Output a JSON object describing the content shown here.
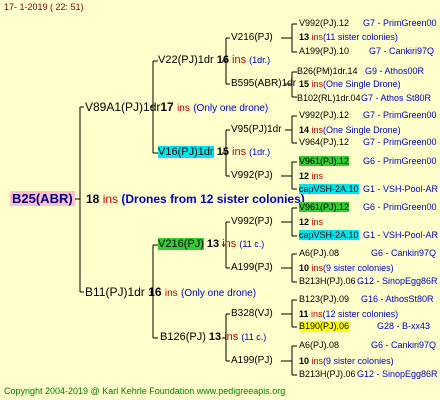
{
  "header": {
    "date": "17-  1-2019 (  22: 51)"
  },
  "footer": {
    "copyright": "Copyright 2004-2019 @ Karl Kehrle Foundation   www.pedigreeapis.org"
  },
  "root": {
    "name": "B25(ABR)",
    "count": "18",
    "unit": "ins",
    "note": "(Drones from 12 sister colonies)"
  },
  "gen1": {
    "upper": {
      "name": "V89A1(PJ)1dr",
      "count": "17",
      "unit": "ins",
      "note": "(Only one drone)"
    },
    "lower": {
      "name": "B11(PJ)1dr",
      "count": "16",
      "unit": "ins",
      "note": "(Only one drone)"
    }
  },
  "gen2": {
    "a": {
      "name": "V22(PJ)1dr",
      "count": "16",
      "unit": "ins",
      "note": "(1dr.)"
    },
    "b": {
      "name": "V16(PJ)1dr",
      "count": "15",
      "unit": "ins",
      "note": "(1dr.)"
    },
    "c": {
      "name": "V216(PJ)",
      "count": "13",
      "unit": "ins",
      "note": "(11 c.)"
    },
    "d": {
      "name": "B126(PJ)",
      "count": "13",
      "unit": "ins",
      "note": "(11 c.)"
    }
  },
  "gen3": {
    "a": {
      "name": "V216(PJ)",
      "count": "13",
      "unit": "ins",
      "note": "(11 sister colonies)"
    },
    "b": {
      "name": "B595(ABR)1dr",
      "count": "15",
      "unit": "ins",
      "note": "(One Single Drone)"
    },
    "c": {
      "name": "V95(PJ)1dr",
      "count": "14",
      "unit": "ins",
      "note": "(One Single Drone)"
    },
    "d": {
      "name": "V992(PJ)",
      "count": "12",
      "unit": "ins",
      "note": ""
    },
    "e": {
      "name": "V992(PJ)",
      "count": "12",
      "unit": "ins",
      "note": ""
    },
    "f": {
      "name": "A199(PJ)",
      "count": "10",
      "unit": "ins",
      "note": "(9 sister colonies)"
    },
    "g": {
      "name": "B328(VJ)",
      "count": "11",
      "unit": "ins",
      "note": "(12 sister colonies)"
    },
    "h": {
      "name": "A199(PJ)",
      "count": "10",
      "unit": "ins",
      "note": "(9 sister colonies)"
    }
  },
  "gen4": [
    {
      "name": "V992(PJ).12",
      "ref": "G7 - PrimGreen00"
    },
    {
      "name": "A199(PJ).10",
      "ref": "G7 - Cankiri97Q"
    },
    {
      "name": "B26(PM)1dr.14",
      "ref": "G9 - Athos00R"
    },
    {
      "name": "B102(RL)1dr.04",
      "ref": "G7 - Athos St80R"
    },
    {
      "name": "V992(PJ).12",
      "ref": "G7 - PrimGreen00"
    },
    {
      "name": "V964(PJ).12",
      "ref": "G7 - PrimGreen00"
    },
    {
      "name": "V961(PJ).12",
      "ref": "G6 - PrimGreen00"
    },
    {
      "name": "capVSH-2A.10",
      "ref": "G1 - VSH-Pool-AR"
    },
    {
      "name": "V961(PJ).12",
      "ref": "G6 - PrimGreen00"
    },
    {
      "name": "capVSH-2A.10",
      "ref": "G1 - VSH-Pool-AR"
    },
    {
      "name": "A6(PJ).08",
      "ref": "G6 - Cankiri97Q"
    },
    {
      "name": "B213H(PJ).06",
      "ref": "G12 - SinopEgg86R"
    },
    {
      "name": "B123(PJ).09",
      "ref": "G16 - AthosSt80R"
    },
    {
      "name": "B190(PJ).06",
      "ref": "G28 - B-xx43"
    },
    {
      "name": "A6(PJ).08",
      "ref": "G6 - Cankiri97Q"
    },
    {
      "name": "B213H(PJ).06",
      "ref": "G12 - SinopEgg86R"
    }
  ],
  "colors": {
    "background": "#ffffcc",
    "lines": "#000000",
    "highlight_green": "#33cc33",
    "highlight_cyan": "#00e5ee",
    "highlight_yellow": "#ffff00",
    "root_bg": "#ffc0cb"
  }
}
